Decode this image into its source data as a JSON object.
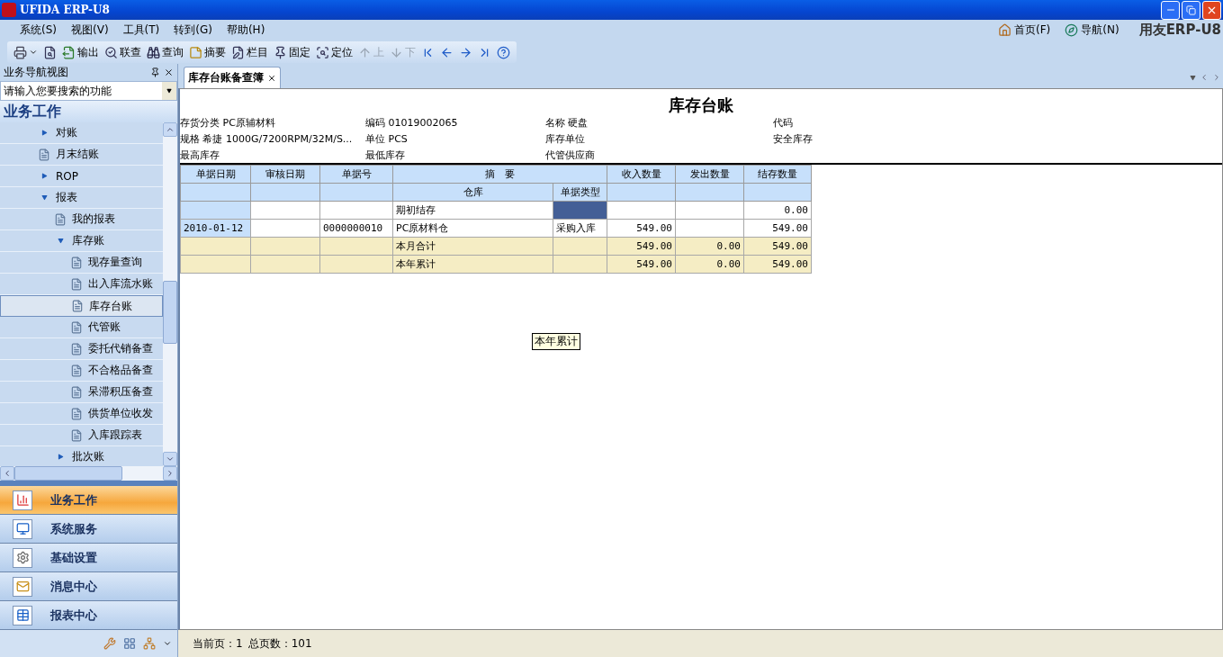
{
  "window": {
    "title": "UFIDA ERP-U8"
  },
  "menu": [
    "系统(S)",
    "视图(V)",
    "工具(T)",
    "转到(G)",
    "帮助(H)"
  ],
  "top_links": [
    {
      "kind": "home",
      "label": "首页(F)"
    },
    {
      "kind": "navigate",
      "label": "导航(N)"
    }
  ],
  "brand": "用友ERP-U8",
  "toolbar": [
    {
      "kind": "print",
      "dropdown": true,
      "disabled": false
    },
    {
      "kind": "preview",
      "disabled": false
    },
    {
      "kind": "export",
      "label": "输出",
      "disabled": false
    },
    {
      "kind": "link-query",
      "label": "联查",
      "disabled": false
    },
    {
      "kind": "query",
      "label": "查询",
      "disabled": false
    },
    {
      "kind": "summary",
      "label": "摘要",
      "disabled": false
    },
    {
      "kind": "columns",
      "label": "栏目",
      "disabled": false
    },
    {
      "kind": "freeze",
      "label": "固定",
      "disabled": false
    },
    {
      "kind": "locate",
      "label": "定位",
      "disabled": false
    },
    {
      "kind": "up",
      "label": "上",
      "disabled": true
    },
    {
      "kind": "down",
      "label": "下",
      "disabled": true
    },
    {
      "kind": "first",
      "disabled": false
    },
    {
      "kind": "previous",
      "disabled": false
    },
    {
      "kind": "next",
      "disabled": false
    },
    {
      "kind": "last",
      "disabled": false
    },
    {
      "kind": "help",
      "disabled": false
    }
  ],
  "navigator": {
    "title": "业务导航视图",
    "search": {
      "placeholder": "请输入您要搜索的功能"
    },
    "section": "业务工作",
    "tree": [
      {
        "label": "对账",
        "kind": "folder",
        "expanded": false,
        "selected": false
      },
      {
        "label": "月末结账",
        "kind": "doc",
        "selected": false
      },
      {
        "label": "ROP",
        "kind": "folder",
        "expanded": false,
        "selected": false
      },
      {
        "label": "报表",
        "kind": "folder",
        "expanded": true,
        "selected": false,
        "children": [
          {
            "label": "我的报表",
            "kind": "doc",
            "selected": false
          },
          {
            "label": "库存账",
            "kind": "folder",
            "expanded": true,
            "selected": false,
            "children": [
              {
                "label": "现存量查询",
                "kind": "doc",
                "selected": false
              },
              {
                "label": "出入库流水账",
                "kind": "doc",
                "selected": false
              },
              {
                "label": "库存台账",
                "kind": "doc",
                "selected": true
              },
              {
                "label": "代管账",
                "kind": "doc",
                "selected": false
              },
              {
                "label": "委托代销备查",
                "kind": "doc",
                "selected": false
              },
              {
                "label": "不合格品备查",
                "kind": "doc",
                "selected": false
              },
              {
                "label": "呆滞积压备查",
                "kind": "doc",
                "selected": false
              },
              {
                "label": "供货单位收发",
                "kind": "doc",
                "selected": false
              },
              {
                "label": "入库跟踪表",
                "kind": "doc",
                "selected": false
              }
            ]
          },
          {
            "label": "批次账",
            "kind": "folder",
            "expanded": false,
            "selected": false
          }
        ]
      }
    ]
  },
  "nav_buttons": [
    {
      "label": "业务工作",
      "kind": "chart",
      "selected": true
    },
    {
      "label": "系统服务",
      "kind": "monitor",
      "selected": false
    },
    {
      "label": "基础设置",
      "kind": "settings",
      "selected": false
    },
    {
      "label": "消息中心",
      "kind": "mail",
      "selected": false
    },
    {
      "label": "报表中心",
      "kind": "report",
      "selected": false
    }
  ],
  "tabs": [
    {
      "label": "库存台账备查簿",
      "selected": true
    }
  ],
  "report": {
    "title": "库存台账",
    "fields": [
      {
        "label": "存货分类",
        "value": "PC原辅材料"
      },
      {
        "label": "编码",
        "value": "01019002065"
      },
      {
        "label": "名称",
        "value": "硬盘"
      },
      {
        "label": "代码"
      },
      {
        "label": "规格",
        "value": "希捷 1000G/7200RPM/32M/S..."
      },
      {
        "label": "单位",
        "value": "PCS"
      },
      {
        "label": "库存单位"
      },
      {
        "label": "安全库存"
      },
      {
        "label": "最高库存"
      },
      {
        "label": "最低库存"
      },
      {
        "label": "代管供应商"
      }
    ],
    "columns": [
      {
        "label": "单据日期"
      },
      {
        "label": "审核日期"
      },
      {
        "label": "单据号"
      },
      {
        "label": "摘　要",
        "subcolumns": [
          "仓库",
          "单据类型"
        ]
      },
      {
        "label": "收入数量"
      },
      {
        "label": "发出数量"
      },
      {
        "label": "结存数量"
      }
    ],
    "rows": [
      {
        "kind": "opening",
        "type_cell_selected": true,
        "cells": {
          "warehouse": "期初结存",
          "balance": "0.00"
        }
      },
      {
        "kind": "detail",
        "type_cell_selected": false,
        "cells": {
          "date": "2010-01-12",
          "doc_no": "0000000010",
          "warehouse": "PC原材料仓",
          "doc_type": "采购入库",
          "in_qty": "549.00",
          "balance": "549.00"
        }
      },
      {
        "kind": "total",
        "type_cell_selected": false,
        "cells": {
          "warehouse": "本月合计",
          "in_qty": "549.00",
          "out_qty": "0.00",
          "balance": "549.00"
        }
      },
      {
        "kind": "total",
        "type_cell_selected": false,
        "cells": {
          "warehouse": "本年累计",
          "in_qty": "549.00",
          "out_qty": "0.00",
          "balance": "549.00"
        }
      }
    ],
    "tooltip": "本年累计"
  },
  "status_bar": {
    "current_page": "当前页：1",
    "total_pages": "总页数：101"
  }
}
